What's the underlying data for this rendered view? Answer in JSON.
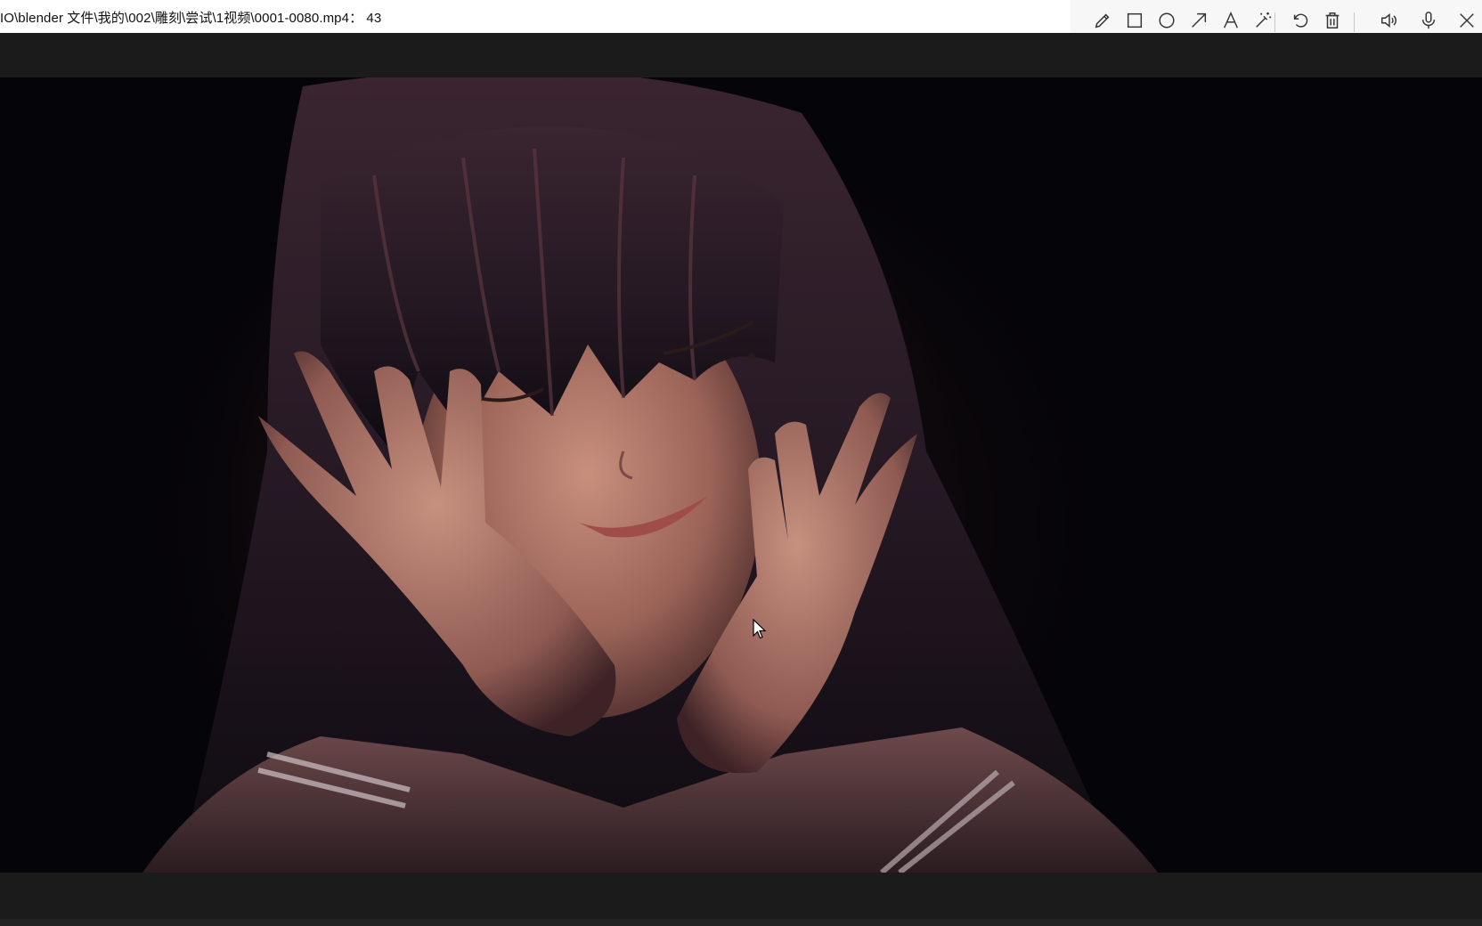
{
  "window": {
    "title": "IO\\blender 文件\\我的\\002\\雕刻\\尝试\\1视频\\0001-0080.mp4： 43"
  },
  "toolbar": {
    "tools": [
      {
        "name": "pencil-icon"
      },
      {
        "name": "rectangle-icon"
      },
      {
        "name": "circle-icon"
      },
      {
        "name": "arrow-icon"
      },
      {
        "name": "text-icon"
      },
      {
        "name": "magic-wand-icon"
      },
      {
        "name": "undo-icon"
      },
      {
        "name": "trash-icon"
      },
      {
        "name": "speaker-icon"
      },
      {
        "name": "microphone-icon"
      },
      {
        "name": "close-icon"
      }
    ]
  },
  "video": {
    "content": "stylized 3D render of a smiling girl with dark bangs resting her face in her hands"
  },
  "colors": {
    "titlebar_bg": "#ffffff",
    "toolbar_bg": "#f7f7f7",
    "player_bar_bg": "#1b1b1b",
    "video_bg": "#040407",
    "icon_color": "#333333"
  }
}
